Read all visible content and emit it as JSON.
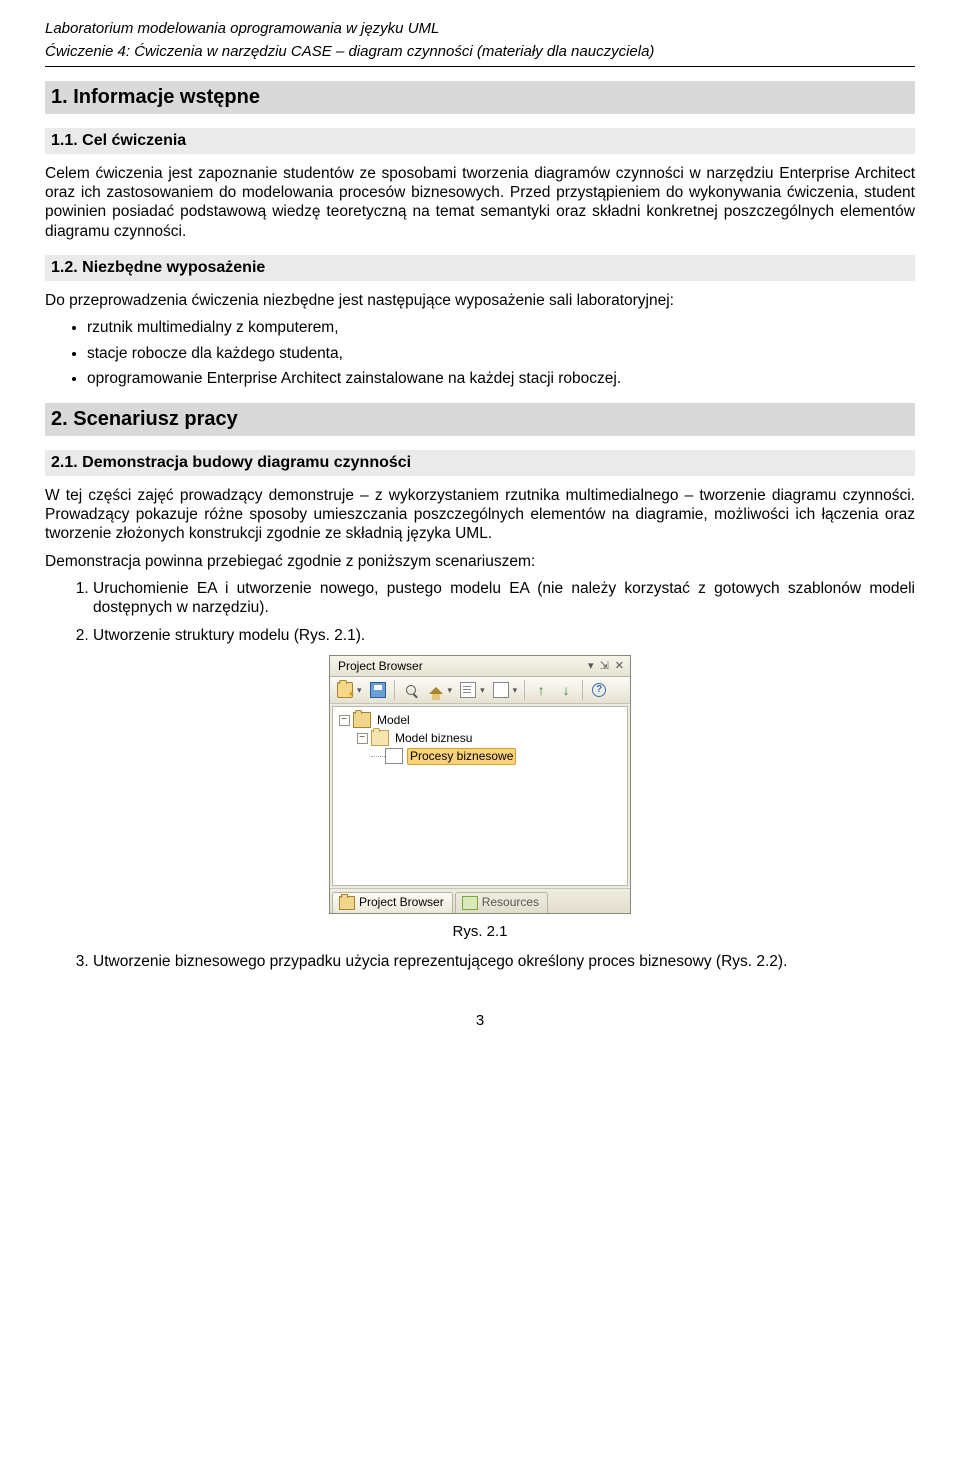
{
  "header": {
    "line1": "Laboratorium modelowania oprogramowania w języku UML",
    "line2": "Ćwiczenie 4: Ćwiczenia w narzędziu CASE – diagram czynności (materiały dla nauczyciela)"
  },
  "s1": {
    "title": "1. Informacje wstępne",
    "s11": {
      "title": "1.1. Cel ćwiczenia",
      "p1": "Celem ćwiczenia jest zapoznanie studentów ze sposobami tworzenia diagramów czynności w narzędziu Enterprise Architect oraz ich zastosowaniem do modelowania procesów biznesowych. Przed przystąpieniem do wykonywania ćwiczenia, student powinien posiadać podstawową wiedzę teoretyczną na temat semantyki oraz składni konkretnej poszczególnych elementów diagramu czynności."
    },
    "s12": {
      "title": "1.2. Niezbędne wyposażenie",
      "intro": "Do przeprowadzenia ćwiczenia niezbędne jest następujące wyposażenie sali laboratoryjnej:",
      "items": [
        "rzutnik multimedialny z komputerem,",
        "stacje robocze dla każdego studenta,",
        "oprogramowanie Enterprise Architect zainstalowane na każdej stacji roboczej."
      ]
    }
  },
  "s2": {
    "title": "2. Scenariusz pracy",
    "s21": {
      "title": "2.1. Demonstracja budowy diagramu czynności",
      "p1": "W tej części zajęć prowadzący demonstruje – z wykorzystaniem rzutnika multimedialnego – tworzenie diagramu czynności. Prowadzący pokazuje różne sposoby umieszczania poszczególnych elementów na diagramie, możliwości ich łączenia oraz tworzenie złożonych konstrukcji zgodnie ze składnią języka UML.",
      "p2": "Demonstracja powinna przebiegać zgodnie z poniższym scenariuszem:",
      "steps": [
        "Uruchomienie EA i utworzenie nowego, pustego modelu EA (nie należy korzystać z gotowych szablonów modeli dostępnych w narzędziu).",
        "Utworzenie struktury modelu (Rys. 2.1).",
        "Utworzenie biznesowego przypadku użycia reprezentującego określony proces biznesowy (Rys. 2.2)."
      ],
      "figcaption": "Rys. 2.1"
    }
  },
  "projectBrowser": {
    "title": "Project Browser",
    "tree": {
      "root": "Model",
      "node1": "Model biznesu",
      "node2": "Procesy biznesowe"
    },
    "tabs": {
      "active": "Project Browser",
      "inactive": "Resources"
    }
  },
  "pagenum": "3"
}
